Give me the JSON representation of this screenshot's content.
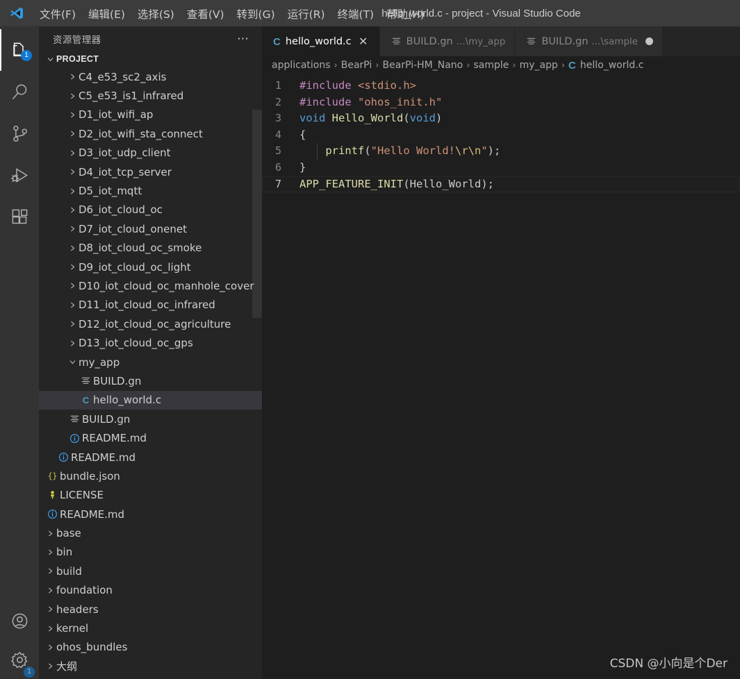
{
  "window": {
    "title": "hello_world.c - project - Visual Studio Code",
    "logo_icon": "vscode-logo"
  },
  "menubar": {
    "items": [
      {
        "label": "文件(F)"
      },
      {
        "label": "编辑(E)"
      },
      {
        "label": "选择(S)"
      },
      {
        "label": "查看(V)"
      },
      {
        "label": "转到(G)"
      },
      {
        "label": "运行(R)"
      },
      {
        "label": "终端(T)"
      },
      {
        "label": "帮助(H)"
      }
    ]
  },
  "activitybar": {
    "items": [
      {
        "name": "explorer",
        "icon": "files-icon",
        "badge": "1",
        "active": true
      },
      {
        "name": "search",
        "icon": "search-icon",
        "badge": "",
        "active": false
      },
      {
        "name": "source-control",
        "icon": "source-control-icon",
        "badge": "",
        "active": false
      },
      {
        "name": "run-debug",
        "icon": "run-debug-icon",
        "badge": "",
        "active": false
      },
      {
        "name": "extensions",
        "icon": "extensions-icon",
        "badge": "",
        "active": false
      }
    ],
    "bottom_items": [
      {
        "name": "accounts",
        "icon": "account-icon",
        "badge": ""
      },
      {
        "name": "settings",
        "icon": "gear-icon",
        "badge": "1"
      }
    ]
  },
  "sidebar": {
    "title": "资源管理器",
    "actions_icon": "more-actions-icon",
    "section": {
      "label": "PROJECT",
      "expanded": true
    },
    "tree": [
      {
        "label": "C4_e53_sc2_axis",
        "type": "folder",
        "indent": 3,
        "state": "collapsed",
        "icon": "chevron-right-icon"
      },
      {
        "label": "C5_e53_is1_infrared",
        "type": "folder",
        "indent": 3,
        "state": "collapsed",
        "icon": "chevron-right-icon"
      },
      {
        "label": "D1_iot_wifi_ap",
        "type": "folder",
        "indent": 3,
        "state": "collapsed",
        "icon": "chevron-right-icon"
      },
      {
        "label": "D2_iot_wifi_sta_connect",
        "type": "folder",
        "indent": 3,
        "state": "collapsed",
        "icon": "chevron-right-icon"
      },
      {
        "label": "D3_iot_udp_client",
        "type": "folder",
        "indent": 3,
        "state": "collapsed",
        "icon": "chevron-right-icon"
      },
      {
        "label": "D4_iot_tcp_server",
        "type": "folder",
        "indent": 3,
        "state": "collapsed",
        "icon": "chevron-right-icon"
      },
      {
        "label": "D5_iot_mqtt",
        "type": "folder",
        "indent": 3,
        "state": "collapsed",
        "icon": "chevron-right-icon"
      },
      {
        "label": "D6_iot_cloud_oc",
        "type": "folder",
        "indent": 3,
        "state": "collapsed",
        "icon": "chevron-right-icon"
      },
      {
        "label": "D7_iot_cloud_onenet",
        "type": "folder",
        "indent": 3,
        "state": "collapsed",
        "icon": "chevron-right-icon"
      },
      {
        "label": "D8_iot_cloud_oc_smoke",
        "type": "folder",
        "indent": 3,
        "state": "collapsed",
        "icon": "chevron-right-icon"
      },
      {
        "label": "D9_iot_cloud_oc_light",
        "type": "folder",
        "indent": 3,
        "state": "collapsed",
        "icon": "chevron-right-icon"
      },
      {
        "label": "D10_iot_cloud_oc_manhole_cover",
        "type": "folder",
        "indent": 3,
        "state": "collapsed",
        "icon": "chevron-right-icon"
      },
      {
        "label": "D11_iot_cloud_oc_infrared",
        "type": "folder",
        "indent": 3,
        "state": "collapsed",
        "icon": "chevron-right-icon"
      },
      {
        "label": "D12_iot_cloud_oc_agriculture",
        "type": "folder",
        "indent": 3,
        "state": "collapsed",
        "icon": "chevron-right-icon"
      },
      {
        "label": "D13_iot_cloud_oc_gps",
        "type": "folder",
        "indent": 3,
        "state": "collapsed",
        "icon": "chevron-right-icon"
      },
      {
        "label": "my_app",
        "type": "folder",
        "indent": 3,
        "state": "expanded",
        "icon": "chevron-down-icon"
      },
      {
        "label": "BUILD.gn",
        "type": "gn",
        "indent": 4,
        "state": "file",
        "icon": "gn-file-icon"
      },
      {
        "label": "hello_world.c",
        "type": "c",
        "indent": 4,
        "state": "file",
        "icon": "c-file-icon",
        "selected": true
      },
      {
        "label": "BUILD.gn",
        "type": "gn",
        "indent": 3,
        "state": "file",
        "icon": "gn-file-icon"
      },
      {
        "label": "README.md",
        "type": "md",
        "indent": 3,
        "state": "file",
        "icon": "markdown-icon"
      },
      {
        "label": "README.md",
        "type": "md",
        "indent": 2,
        "state": "file",
        "icon": "markdown-icon"
      },
      {
        "label": "bundle.json",
        "type": "json",
        "indent": 1,
        "state": "file",
        "icon": "json-icon"
      },
      {
        "label": "LICENSE",
        "type": "license",
        "indent": 1,
        "state": "file",
        "icon": "license-icon"
      },
      {
        "label": "README.md",
        "type": "md",
        "indent": 1,
        "state": "file",
        "icon": "markdown-icon"
      },
      {
        "label": "base",
        "type": "folder",
        "indent": 1,
        "state": "collapsed",
        "icon": "chevron-right-icon"
      },
      {
        "label": "bin",
        "type": "folder",
        "indent": 1,
        "state": "collapsed",
        "icon": "chevron-right-icon"
      },
      {
        "label": "build",
        "type": "folder",
        "indent": 1,
        "state": "collapsed",
        "icon": "chevron-right-icon"
      },
      {
        "label": "foundation",
        "type": "folder",
        "indent": 1,
        "state": "collapsed",
        "icon": "chevron-right-icon"
      },
      {
        "label": "headers",
        "type": "folder",
        "indent": 1,
        "state": "collapsed",
        "icon": "chevron-right-icon"
      },
      {
        "label": "kernel",
        "type": "folder",
        "indent": 1,
        "state": "collapsed",
        "icon": "chevron-right-icon"
      },
      {
        "label": "ohos_bundles",
        "type": "folder",
        "indent": 1,
        "state": "collapsed",
        "icon": "chevron-right-icon"
      },
      {
        "label": "大纲",
        "type": "folder",
        "indent": 1,
        "state": "collapsed",
        "icon": "chevron-right-icon"
      }
    ]
  },
  "tabs": [
    {
      "label": "hello_world.c",
      "desc": "",
      "icon": "c-file-icon",
      "active": true,
      "dirty": false,
      "close_icon": "close-icon"
    },
    {
      "label": "BUILD.gn",
      "desc": "...\\my_app",
      "icon": "gn-file-icon",
      "active": false,
      "dirty": false,
      "close_icon": "close-icon"
    },
    {
      "label": "BUILD.gn",
      "desc": "...\\sample",
      "icon": "gn-file-icon",
      "active": false,
      "dirty": true,
      "close_icon": "close-icon"
    }
  ],
  "breadcrumb": {
    "separator": "›",
    "items": [
      "applications",
      "BearPi",
      "BearPi-HM_Nano",
      "sample",
      "my_app"
    ],
    "file": "hello_world.c",
    "file_icon": "c-file-icon"
  },
  "editor": {
    "current_line": 7,
    "lines": [
      {
        "num": "1",
        "tokens": [
          {
            "t": "#include",
            "c": "t-pre"
          },
          {
            "t": " ",
            "c": "t-punct"
          },
          {
            "t": "<stdio.h>",
            "c": "t-inc"
          }
        ]
      },
      {
        "num": "2",
        "tokens": [
          {
            "t": "#include",
            "c": "t-pre"
          },
          {
            "t": " ",
            "c": "t-punct"
          },
          {
            "t": "\"ohos_init.h\"",
            "c": "t-inc"
          }
        ]
      },
      {
        "num": "3",
        "tokens": [
          {
            "t": "void",
            "c": "t-kw"
          },
          {
            "t": " ",
            "c": "t-punct"
          },
          {
            "t": "Hello_World",
            "c": "t-fn"
          },
          {
            "t": "(",
            "c": "t-punct"
          },
          {
            "t": "void",
            "c": "t-kw"
          },
          {
            "t": ")",
            "c": "t-punct"
          }
        ]
      },
      {
        "num": "4",
        "tokens": [
          {
            "t": "{",
            "c": "t-punct"
          }
        ]
      },
      {
        "num": "5",
        "tokens": [
          {
            "t": "    ",
            "c": "t-punct"
          },
          {
            "t": "printf",
            "c": "t-fn"
          },
          {
            "t": "(",
            "c": "t-punct"
          },
          {
            "t": "\"Hello World!",
            "c": "t-str"
          },
          {
            "t": "\\r\\n",
            "c": "t-esc"
          },
          {
            "t": "\"",
            "c": "t-str"
          },
          {
            "t": ");",
            "c": "t-punct"
          }
        ]
      },
      {
        "num": "6",
        "tokens": [
          {
            "t": "}",
            "c": "t-punct"
          }
        ]
      },
      {
        "num": "7",
        "tokens": [
          {
            "t": "APP_FEATURE_INIT",
            "c": "t-macro"
          },
          {
            "t": "(",
            "c": "t-punct"
          },
          {
            "t": "Hello_World",
            "c": "t-punct"
          },
          {
            "t": ");",
            "c": "t-punct"
          }
        ]
      }
    ]
  },
  "watermark": {
    "text": "CSDN @小向是个Der"
  },
  "colors": {
    "accent": "#0e7ad4",
    "titlebar_bg": "#3c3c3c",
    "activitybar_bg": "#333333",
    "sidebar_bg": "#252526",
    "editor_bg": "#1e1e1e",
    "tab_inactive_bg": "#2d2d2d",
    "selection_bg": "#37373d",
    "c_icon": "#519aba",
    "md_icon": "#42a5f5",
    "json_icon": "#cbcb41",
    "license_icon": "#cbcb41"
  }
}
